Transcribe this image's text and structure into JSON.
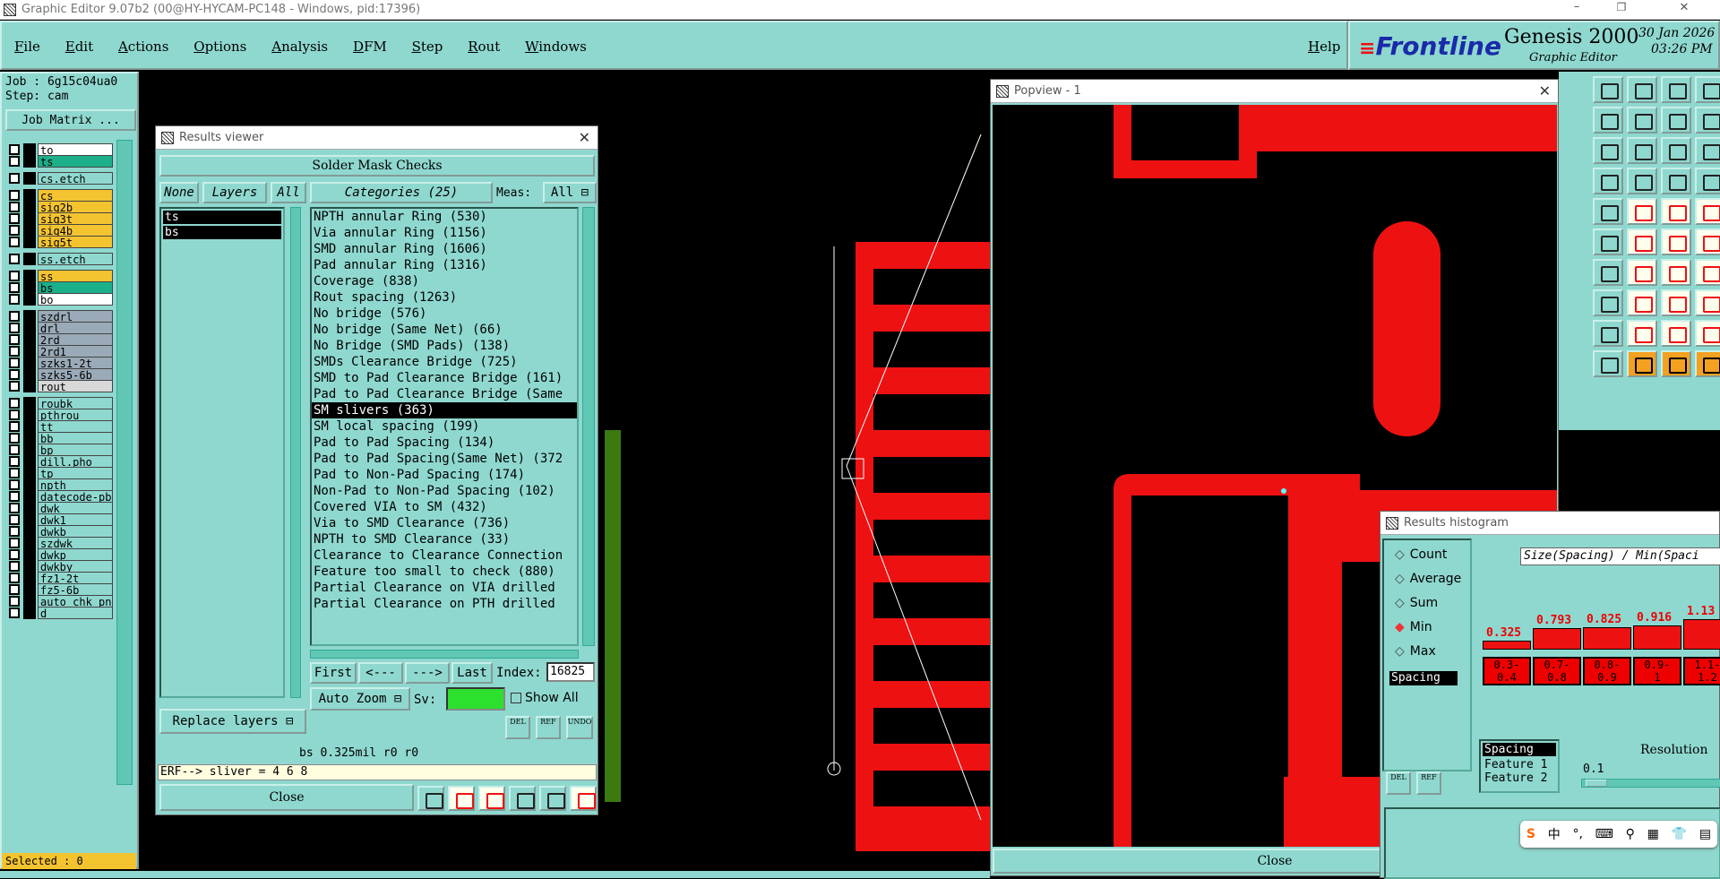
{
  "window": {
    "title": "Graphic Editor 9.07b2 (00@HY-HYCAM-PC148 - Windows, pid:17396)",
    "controls": [
      "–",
      "❐",
      "✕"
    ]
  },
  "menu": {
    "items": [
      "File",
      "Edit",
      "Actions",
      "Options",
      "Analysis",
      "DFM",
      "Step",
      "Rout",
      "Windows"
    ],
    "help": "Help"
  },
  "brand": {
    "logo": "Frontline",
    "product": "Genesis 2000",
    "subtitle": "Graphic Editor",
    "date": "30 Jan 2026",
    "time": "03:26 PM"
  },
  "job_panel": {
    "job": "Job : 6g15c04ua0",
    "step": "Step: cam",
    "job_matrix": "Job Matrix ...",
    "selected": "Selected : 0",
    "layers": [
      {
        "name": "to",
        "color": "#ffffff"
      },
      {
        "name": "ts",
        "color": "#1bb089"
      },
      {
        "name": "cs.etch",
        "color": "#8fd8cf"
      },
      {
        "name": "cs",
        "color": "#f4c430"
      },
      {
        "name": "sig2b",
        "color": "#f4c430"
      },
      {
        "name": "sig3t",
        "color": "#f4c430"
      },
      {
        "name": "sig4b",
        "color": "#f4c430"
      },
      {
        "name": "sig5t",
        "color": "#f4c430"
      },
      {
        "name": "ss.etch",
        "color": "#8fd8cf"
      },
      {
        "name": "ss",
        "color": "#f4c430"
      },
      {
        "name": "bs",
        "color": "#1bb089"
      },
      {
        "name": "bo",
        "color": "#ffffff"
      },
      {
        "name": "szdrl",
        "color": "#9aaab8"
      },
      {
        "name": "drl",
        "color": "#9aaab8"
      },
      {
        "name": "2rd",
        "color": "#9aaab8"
      },
      {
        "name": "2rd1",
        "color": "#9aaab8"
      },
      {
        "name": "szks1-2t",
        "color": "#9aaab8"
      },
      {
        "name": "szks5-6b",
        "color": "#9aaab8"
      },
      {
        "name": "rout",
        "color": "#d8d8d8"
      },
      {
        "name": "roubk",
        "color": "#8fd8cf"
      },
      {
        "name": "pthrou",
        "color": "#8fd8cf"
      },
      {
        "name": "tt",
        "color": "#8fd8cf"
      },
      {
        "name": "bb",
        "color": "#8fd8cf"
      },
      {
        "name": "bp",
        "color": "#8fd8cf"
      },
      {
        "name": "dill.pho",
        "color": "#8fd8cf"
      },
      {
        "name": "tp",
        "color": "#8fd8cf"
      },
      {
        "name": "npth",
        "color": "#8fd8cf"
      },
      {
        "name": "datecode-pbe",
        "color": "#8fd8cf"
      },
      {
        "name": "dwk",
        "color": "#8fd8cf"
      },
      {
        "name": "dwk1",
        "color": "#8fd8cf"
      },
      {
        "name": "dwkb",
        "color": "#8fd8cf"
      },
      {
        "name": "szdwk",
        "color": "#8fd8cf"
      },
      {
        "name": "dwkp",
        "color": "#8fd8cf"
      },
      {
        "name": "dwkby",
        "color": "#8fd8cf"
      },
      {
        "name": "fz1-2t",
        "color": "#8fd8cf"
      },
      {
        "name": "fz5-6b",
        "color": "#8fd8cf"
      },
      {
        "name": "auto_chk_pn",
        "color": "#8fd8cf"
      },
      {
        "name": "d",
        "color": "#8fd8cf"
      }
    ]
  },
  "results_viewer": {
    "title": "Results viewer",
    "header": "Solder Mask Checks",
    "none": "None",
    "layers": "Layers",
    "all": "All",
    "categories_label": "Categories (25)",
    "meas_label": "Meas:",
    "meas_value": "All",
    "layer_list": [
      "ts",
      "bs"
    ],
    "categories": [
      "NPTH annular Ring (530)",
      "Via annular Ring (1156)",
      "SMD annular Ring (1606)",
      "Pad annular Ring (1316)",
      "Coverage (838)",
      "Rout spacing (1263)",
      "No bridge (576)",
      "No bridge (Same Net) (66)",
      "No Bridge (SMD Pads) (138)",
      "SMDs Clearance Bridge (725)",
      "SMD to Pad Clearance Bridge (161)",
      "Pad to Pad Clearance Bridge (Same",
      "SM slivers (363)",
      "SM local spacing (199)",
      "Pad to Pad Spacing (134)",
      "Pad to Pad Spacing(Same Net) (372",
      "Pad to Non-Pad Spacing (174)",
      "Non-Pad to Non-Pad Spacing (102)",
      "Covered VIA to SM (432)",
      "Via to SMD Clearance (736)",
      "NPTH to SMD Clearance (33)",
      "Clearance to Clearance Connection",
      "Feature too small to check (880)",
      "Partial Clearance on VIA drilled",
      "Partial Clearance on PTH drilled"
    ],
    "selected_index": 12,
    "first": "First",
    "prev": "<---",
    "next": "--->",
    "last": "Last",
    "index_label": "Index:",
    "index_value": "16825",
    "auto_zoom": "Auto Zoom",
    "sv_label": "Sv:",
    "show_all": "Show All",
    "replace_layers": "Replace layers",
    "status_line": "bs 0.325mil  r0  r0",
    "erf_line": "ERF--> sliver = 4 6 8",
    "close": "Close",
    "mini_btns": [
      "DEL",
      "REF",
      "UNDO"
    ]
  },
  "popview": {
    "title": "Popview - 1",
    "close": "Close"
  },
  "histogram": {
    "title": "Results histogram",
    "options": [
      "Count",
      "Average",
      "Sum",
      "Min",
      "Max"
    ],
    "selected_option": "Min",
    "measure_item": "Spacing",
    "header": "Size(Spacing) / Min(Spaci",
    "bars": [
      {
        "value": "0.325",
        "range": "0.3-\n0.4"
      },
      {
        "value": "0.793",
        "range": "0.7-\n0.8"
      },
      {
        "value": "0.825",
        "range": "0.8-\n0.9"
      },
      {
        "value": "0.916",
        "range": "0.9-\n1"
      },
      {
        "value": "1.13",
        "range": "1.1-\n1.2"
      }
    ],
    "attr_list": [
      "Spacing",
      "Feature 1",
      "Feature 2"
    ],
    "resolution_label": "Resolution",
    "resolution_value": "0.1",
    "mini_btns": [
      "DEL",
      "REF"
    ]
  },
  "ime_bar": {
    "items": [
      "S",
      "中",
      "°,",
      "⌨",
      "⚲",
      "▦",
      "👕",
      "▤"
    ]
  }
}
